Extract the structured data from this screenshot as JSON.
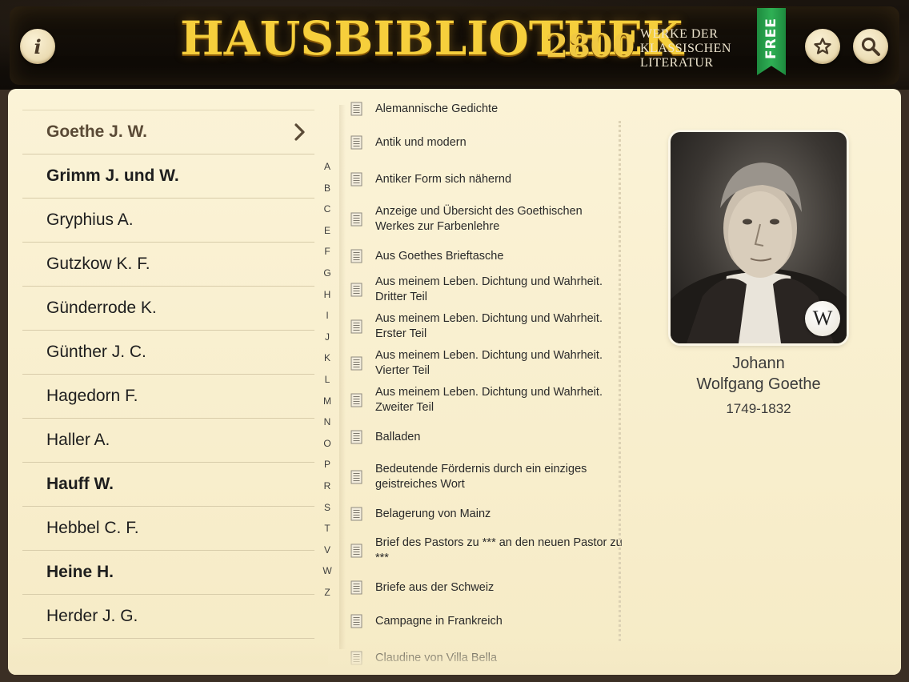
{
  "header": {
    "title": "HAUSBIBLIOTHEK",
    "count": "2800",
    "subtitle_lines": [
      "WERKE DER",
      "KLASSISCHEN",
      "LITERATUR"
    ],
    "ribbon": "FREE",
    "info_label": "i"
  },
  "authors": [
    {
      "name": "Goethe J. W.",
      "bold": true,
      "selected": true
    },
    {
      "name": "Grimm J. und W.",
      "bold": true,
      "selected": false
    },
    {
      "name": "Gryphius A.",
      "bold": false,
      "selected": false
    },
    {
      "name": "Gutzkow K. F.",
      "bold": false,
      "selected": false
    },
    {
      "name": "Günderrode K.",
      "bold": false,
      "selected": false
    },
    {
      "name": "Günther J. C.",
      "bold": false,
      "selected": false
    },
    {
      "name": "Hagedorn F.",
      "bold": false,
      "selected": false
    },
    {
      "name": "Haller A.",
      "bold": false,
      "selected": false
    },
    {
      "name": "Hauff W.",
      "bold": true,
      "selected": false
    },
    {
      "name": "Hebbel C. F.",
      "bold": false,
      "selected": false
    },
    {
      "name": "Heine H.",
      "bold": true,
      "selected": false
    },
    {
      "name": "Herder J. G.",
      "bold": false,
      "selected": false
    }
  ],
  "alphabet": [
    "A",
    "B",
    "C",
    "E",
    "F",
    "G",
    "H",
    "I",
    "J",
    "K",
    "L",
    "M",
    "N",
    "O",
    "P",
    "R",
    "S",
    "T",
    "V",
    "W",
    "Z"
  ],
  "works": [
    "Alemannische Gedichte",
    "Antik und modern",
    "Antiker Form sich nähernd",
    "Anzeige und Übersicht des Goethischen Werkes zur Farbenlehre",
    "Aus Goethes Brieftasche",
    "Aus meinem Leben. Dichtung und Wahrheit. Dritter Teil",
    "Aus meinem Leben. Dichtung und Wahrheit. Erster Teil",
    "Aus meinem Leben. Dichtung und Wahrheit. Vierter Teil",
    "Aus meinem Leben. Dichtung und Wahrheit. Zweiter Teil",
    "Balladen",
    "Bedeutende Fördernis durch ein einziges geistreiches Wort",
    "Belagerung von Mainz",
    "Brief des Pastors zu *** an den neuen Pastor zu ***",
    "Briefe aus der Schweiz",
    "Campagne in Frankreich",
    "Claudine von Villa Bella"
  ],
  "author_detail": {
    "first_name": "Johann",
    "rest_name": "Wolfgang Goethe",
    "years": "1749-1832",
    "wiki_label": "W"
  },
  "colors": {
    "accent_gold": "#f6cf3c",
    "ribbon_green": "#2fb055",
    "paper": "#fbf3d7"
  }
}
